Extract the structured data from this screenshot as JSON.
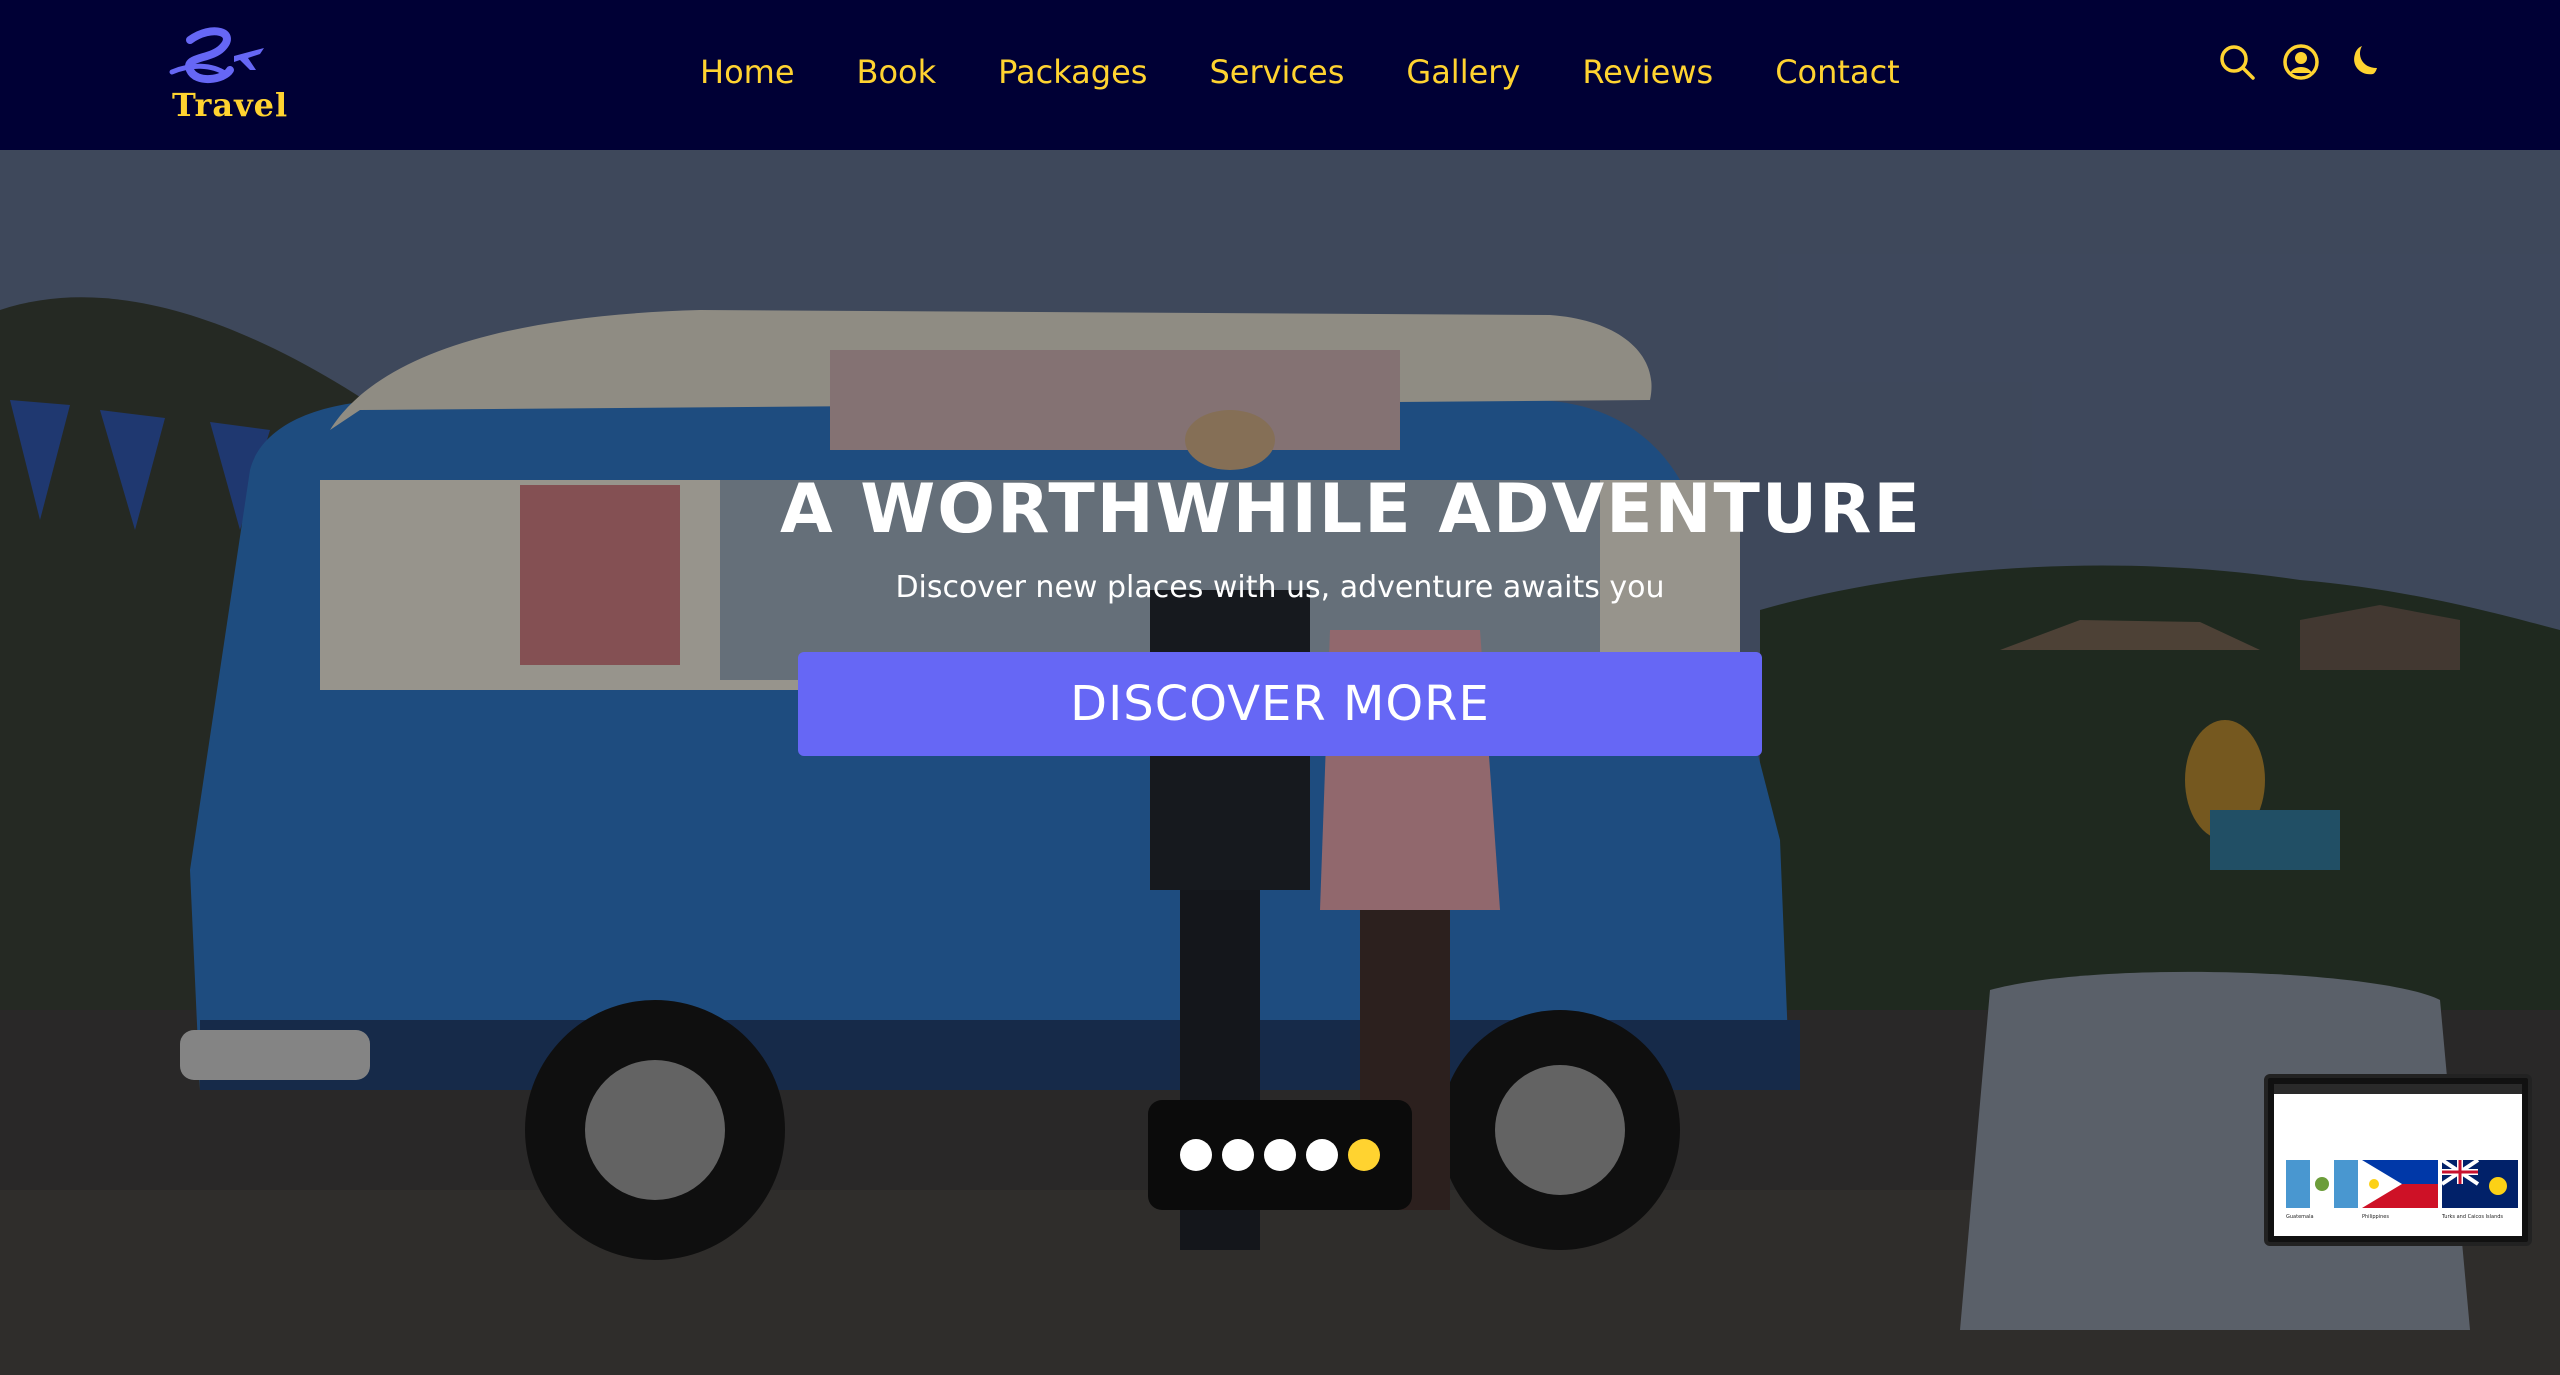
{
  "brand": {
    "logo_text": "Travel",
    "accent_color": "#ffd330",
    "logo_color": "#6667f5"
  },
  "nav": {
    "links": [
      "Home",
      "Book",
      "Packages",
      "Services",
      "Gallery",
      "Reviews",
      "Contact"
    ],
    "icons": [
      "search-icon",
      "user-icon",
      "moon-icon"
    ]
  },
  "hero": {
    "title": "A WORTHWHILE ADVENTURE",
    "subtitle": "Discover new places with us, adventure awaits you",
    "cta_label": "DISCOVER MORE",
    "cta_color": "#6667f5"
  },
  "carousel": {
    "total": 5,
    "active_index": 4
  },
  "thumbnail": {
    "items": [
      "Guatemala",
      "Philippines",
      "Turks and Caicos Islands"
    ]
  }
}
